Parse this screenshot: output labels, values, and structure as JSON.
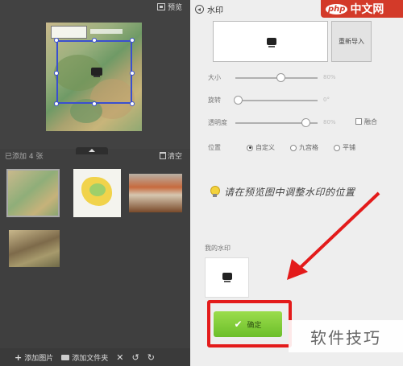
{
  "left": {
    "preview_label": "预览",
    "added_label": "已添加 4 张",
    "clear_label": "清空",
    "bottom": {
      "add_image": "添加图片",
      "add_folder": "添加文件夹"
    }
  },
  "right": {
    "title": "水印",
    "reimport_label": "重新导入",
    "size": {
      "label": "大小",
      "value_text": "80%",
      "level": 0.55
    },
    "rotate": {
      "label": "旋转",
      "value_text": "0°",
      "level": 0.02
    },
    "opacity": {
      "label": "透明度",
      "value_text": "80%",
      "level": 0.83
    },
    "blend_label": "融合",
    "position": {
      "label": "位置",
      "options": [
        "自定义",
        "九宫格",
        "平铺"
      ],
      "selected": "自定义"
    },
    "hint": "请在预览图中调整水印的位置",
    "my_watermark_label": "我的水印",
    "confirm_label": "确定"
  },
  "overlay": {
    "brand_text": "软件技巧",
    "php_logo": "中文网",
    "php_mark": "php",
    "annotation_color": "#e31b1b"
  }
}
